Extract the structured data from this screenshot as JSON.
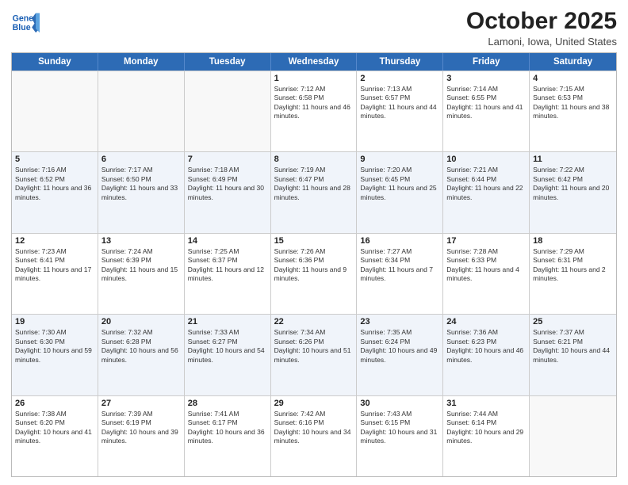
{
  "header": {
    "logo_line1": "General",
    "logo_line2": "Blue",
    "month": "October 2025",
    "location": "Lamoni, Iowa, United States"
  },
  "weekdays": [
    "Sunday",
    "Monday",
    "Tuesday",
    "Wednesday",
    "Thursday",
    "Friday",
    "Saturday"
  ],
  "rows": [
    {
      "alt": false,
      "cells": [
        {
          "day": "",
          "info": ""
        },
        {
          "day": "",
          "info": ""
        },
        {
          "day": "",
          "info": ""
        },
        {
          "day": "1",
          "info": "Sunrise: 7:12 AM\nSunset: 6:58 PM\nDaylight: 11 hours and 46 minutes."
        },
        {
          "day": "2",
          "info": "Sunrise: 7:13 AM\nSunset: 6:57 PM\nDaylight: 11 hours and 44 minutes."
        },
        {
          "day": "3",
          "info": "Sunrise: 7:14 AM\nSunset: 6:55 PM\nDaylight: 11 hours and 41 minutes."
        },
        {
          "day": "4",
          "info": "Sunrise: 7:15 AM\nSunset: 6:53 PM\nDaylight: 11 hours and 38 minutes."
        }
      ]
    },
    {
      "alt": true,
      "cells": [
        {
          "day": "5",
          "info": "Sunrise: 7:16 AM\nSunset: 6:52 PM\nDaylight: 11 hours and 36 minutes."
        },
        {
          "day": "6",
          "info": "Sunrise: 7:17 AM\nSunset: 6:50 PM\nDaylight: 11 hours and 33 minutes."
        },
        {
          "day": "7",
          "info": "Sunrise: 7:18 AM\nSunset: 6:49 PM\nDaylight: 11 hours and 30 minutes."
        },
        {
          "day": "8",
          "info": "Sunrise: 7:19 AM\nSunset: 6:47 PM\nDaylight: 11 hours and 28 minutes."
        },
        {
          "day": "9",
          "info": "Sunrise: 7:20 AM\nSunset: 6:45 PM\nDaylight: 11 hours and 25 minutes."
        },
        {
          "day": "10",
          "info": "Sunrise: 7:21 AM\nSunset: 6:44 PM\nDaylight: 11 hours and 22 minutes."
        },
        {
          "day": "11",
          "info": "Sunrise: 7:22 AM\nSunset: 6:42 PM\nDaylight: 11 hours and 20 minutes."
        }
      ]
    },
    {
      "alt": false,
      "cells": [
        {
          "day": "12",
          "info": "Sunrise: 7:23 AM\nSunset: 6:41 PM\nDaylight: 11 hours and 17 minutes."
        },
        {
          "day": "13",
          "info": "Sunrise: 7:24 AM\nSunset: 6:39 PM\nDaylight: 11 hours and 15 minutes."
        },
        {
          "day": "14",
          "info": "Sunrise: 7:25 AM\nSunset: 6:37 PM\nDaylight: 11 hours and 12 minutes."
        },
        {
          "day": "15",
          "info": "Sunrise: 7:26 AM\nSunset: 6:36 PM\nDaylight: 11 hours and 9 minutes."
        },
        {
          "day": "16",
          "info": "Sunrise: 7:27 AM\nSunset: 6:34 PM\nDaylight: 11 hours and 7 minutes."
        },
        {
          "day": "17",
          "info": "Sunrise: 7:28 AM\nSunset: 6:33 PM\nDaylight: 11 hours and 4 minutes."
        },
        {
          "day": "18",
          "info": "Sunrise: 7:29 AM\nSunset: 6:31 PM\nDaylight: 11 hours and 2 minutes."
        }
      ]
    },
    {
      "alt": true,
      "cells": [
        {
          "day": "19",
          "info": "Sunrise: 7:30 AM\nSunset: 6:30 PM\nDaylight: 10 hours and 59 minutes."
        },
        {
          "day": "20",
          "info": "Sunrise: 7:32 AM\nSunset: 6:28 PM\nDaylight: 10 hours and 56 minutes."
        },
        {
          "day": "21",
          "info": "Sunrise: 7:33 AM\nSunset: 6:27 PM\nDaylight: 10 hours and 54 minutes."
        },
        {
          "day": "22",
          "info": "Sunrise: 7:34 AM\nSunset: 6:26 PM\nDaylight: 10 hours and 51 minutes."
        },
        {
          "day": "23",
          "info": "Sunrise: 7:35 AM\nSunset: 6:24 PM\nDaylight: 10 hours and 49 minutes."
        },
        {
          "day": "24",
          "info": "Sunrise: 7:36 AM\nSunset: 6:23 PM\nDaylight: 10 hours and 46 minutes."
        },
        {
          "day": "25",
          "info": "Sunrise: 7:37 AM\nSunset: 6:21 PM\nDaylight: 10 hours and 44 minutes."
        }
      ]
    },
    {
      "alt": false,
      "cells": [
        {
          "day": "26",
          "info": "Sunrise: 7:38 AM\nSunset: 6:20 PM\nDaylight: 10 hours and 41 minutes."
        },
        {
          "day": "27",
          "info": "Sunrise: 7:39 AM\nSunset: 6:19 PM\nDaylight: 10 hours and 39 minutes."
        },
        {
          "day": "28",
          "info": "Sunrise: 7:41 AM\nSunset: 6:17 PM\nDaylight: 10 hours and 36 minutes."
        },
        {
          "day": "29",
          "info": "Sunrise: 7:42 AM\nSunset: 6:16 PM\nDaylight: 10 hours and 34 minutes."
        },
        {
          "day": "30",
          "info": "Sunrise: 7:43 AM\nSunset: 6:15 PM\nDaylight: 10 hours and 31 minutes."
        },
        {
          "day": "31",
          "info": "Sunrise: 7:44 AM\nSunset: 6:14 PM\nDaylight: 10 hours and 29 minutes."
        },
        {
          "day": "",
          "info": ""
        }
      ]
    }
  ]
}
